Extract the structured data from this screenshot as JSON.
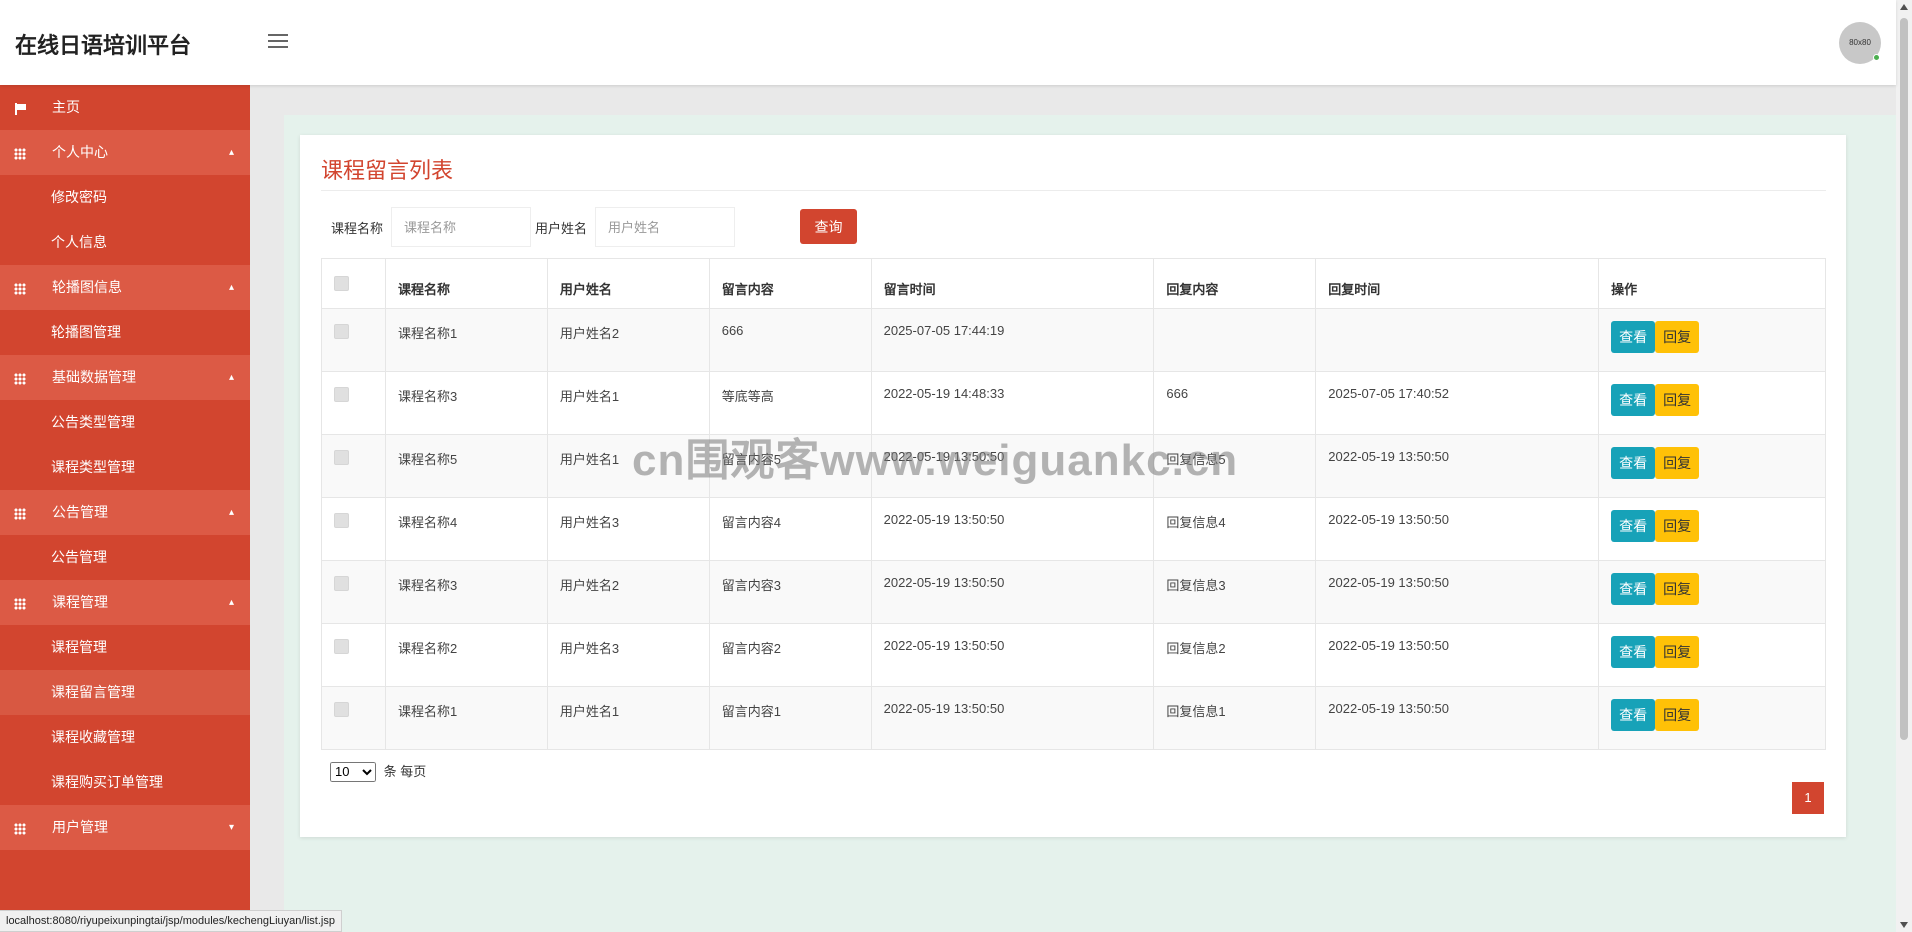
{
  "header": {
    "brand": "在线日语培训平台",
    "avatar_text": "80x80"
  },
  "sidebar": {
    "items": [
      {
        "type": "home",
        "label": "主页",
        "icon": "flag-icon"
      },
      {
        "type": "group",
        "label": "个人中心",
        "icon": "grid-icon",
        "caret": "▴"
      },
      {
        "type": "sub",
        "label": "修改密码"
      },
      {
        "type": "sub",
        "label": "个人信息"
      },
      {
        "type": "group",
        "label": "轮播图信息",
        "icon": "grid-icon",
        "caret": "▴"
      },
      {
        "type": "sub",
        "label": "轮播图管理"
      },
      {
        "type": "group",
        "label": "基础数据管理",
        "icon": "grid-icon",
        "caret": "▴"
      },
      {
        "type": "sub",
        "label": "公告类型管理"
      },
      {
        "type": "sub",
        "label": "课程类型管理"
      },
      {
        "type": "group",
        "label": "公告管理",
        "icon": "grid-icon",
        "caret": "▴"
      },
      {
        "type": "sub",
        "label": "公告管理"
      },
      {
        "type": "group",
        "label": "课程管理",
        "icon": "grid-icon",
        "caret": "▴"
      },
      {
        "type": "sub",
        "label": "课程管理"
      },
      {
        "type": "sub",
        "label": "课程留言管理",
        "active": true
      },
      {
        "type": "sub",
        "label": "课程收藏管理"
      },
      {
        "type": "sub",
        "label": "课程购买订单管理"
      },
      {
        "type": "group",
        "label": "用户管理",
        "icon": "grid-icon",
        "caret": "▾"
      }
    ]
  },
  "main": {
    "title": "课程留言列表",
    "search": {
      "course_label": "课程名称",
      "course_placeholder": "课程名称",
      "user_label": "用户姓名",
      "user_placeholder": "用户姓名",
      "button": "查询"
    },
    "table": {
      "headers": [
        "课程名称",
        "用户姓名",
        "留言内容",
        "留言时间",
        "回复内容",
        "回复时间",
        "操作"
      ],
      "rows": [
        {
          "course": "课程名称1",
          "user": "用户姓名2",
          "content": "666",
          "time": "2025-07-05 17:44:19",
          "reply": "",
          "reply_time": ""
        },
        {
          "course": "课程名称3",
          "user": "用户姓名1",
          "content": "等底等高",
          "time": "2022-05-19 14:48:33",
          "reply": "666",
          "reply_time": "2025-07-05 17:40:52"
        },
        {
          "course": "课程名称5",
          "user": "用户姓名1",
          "content": "留言内容5",
          "time": "2022-05-19 13:50:50",
          "reply": "回复信息5",
          "reply_time": "2022-05-19 13:50:50"
        },
        {
          "course": "课程名称4",
          "user": "用户姓名3",
          "content": "留言内容4",
          "time": "2022-05-19 13:50:50",
          "reply": "回复信息4",
          "reply_time": "2022-05-19 13:50:50"
        },
        {
          "course": "课程名称3",
          "user": "用户姓名2",
          "content": "留言内容3",
          "time": "2022-05-19 13:50:50",
          "reply": "回复信息3",
          "reply_time": "2022-05-19 13:50:50"
        },
        {
          "course": "课程名称2",
          "user": "用户姓名3",
          "content": "留言内容2",
          "time": "2022-05-19 13:50:50",
          "reply": "回复信息2",
          "reply_time": "2022-05-19 13:50:50"
        },
        {
          "course": "课程名称1",
          "user": "用户姓名1",
          "content": "留言内容1",
          "time": "2022-05-19 13:50:50",
          "reply": "回复信息1",
          "reply_time": "2022-05-19 13:50:50"
        }
      ],
      "view_label": "查看",
      "reply_label": "回复"
    },
    "pager": {
      "page_size": "10",
      "page_size_suffix": "条 每页",
      "current_page": "1"
    }
  },
  "watermark": "cn围观客www.weiguankc.cn",
  "status_url": "localhost:8080/riyupeixunpingtai/jsp/modules/kechengLiuyan/list.jsp",
  "colors": {
    "brand_red": "#d2452f",
    "view_button": "#17a2b8",
    "reply_button": "#ffc107"
  }
}
